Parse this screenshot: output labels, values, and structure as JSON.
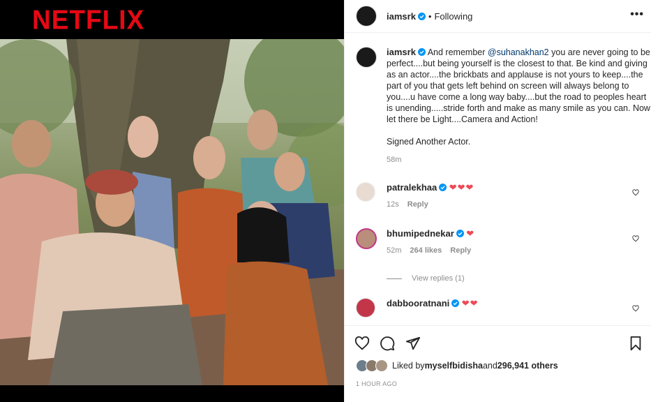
{
  "media": {
    "logo": "NETFLIX"
  },
  "post": {
    "username": "iamsrk",
    "following": "Following",
    "more": "•••"
  },
  "caption": {
    "username": "iamsrk",
    "text_before": "And remember ",
    "mention": "@suhanakhan2",
    "text_after": " you are never going to be perfect....but being yourself is the closest to that. Be kind and giving as an actor....the brickbats and applause is not yours to keep....the part of you that gets left behind on screen will always belong to you....u have come a long way baby....but the road to peoples heart is unending.....stride forth and make as many smile as you can. Now let there be Light....Camera and Action!",
    "signed": "Signed Another Actor.",
    "time": "58m"
  },
  "comments": [
    {
      "username": "patralekhaa",
      "hearts": "❤❤❤",
      "time": "12s",
      "likes": "",
      "reply": "Reply"
    },
    {
      "username": "bhumipednekar",
      "hearts": "❤",
      "time": "52m",
      "likes": "264 likes",
      "reply": "Reply"
    },
    {
      "username": "dabbooratnani",
      "hearts": "❤❤",
      "time": "",
      "likes": "",
      "reply": ""
    }
  ],
  "view_replies": "View replies (1)",
  "likes_line": {
    "prefix": "Liked by ",
    "user": "myselfbidisha",
    "and": " and ",
    "count": "296,941 others"
  },
  "timestamp": "1 HOUR AGO",
  "colors": {
    "netflix_red": "#e50914",
    "heart": "#ed4956",
    "verified": "#0095f6",
    "link": "#00376b",
    "muted": "#8e8e8e"
  }
}
